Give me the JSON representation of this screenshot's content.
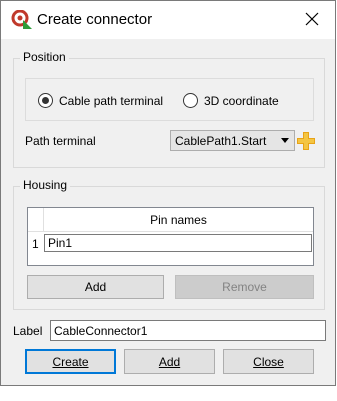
{
  "window": {
    "title": "Create connector"
  },
  "position_group": {
    "title": "Position",
    "radio_cable_path": "Cable path terminal",
    "radio_3d": "3D coordinate",
    "path_terminal_label": "Path terminal",
    "path_terminal_value": "CablePath1.Start"
  },
  "housing_group": {
    "title": "Housing",
    "table_header": "Pin names",
    "rows": [
      {
        "index": "1",
        "value": "Pin1"
      }
    ],
    "add_label": "Add",
    "remove_label": "Remove"
  },
  "label_field": {
    "label": "Label",
    "value": "CableConnector1"
  },
  "footer": {
    "create_label": "Create",
    "add_label": "Add",
    "close_label": "Close"
  },
  "colors": {
    "focus_border": "#0078d7",
    "accent_plus": "#e8a317"
  }
}
